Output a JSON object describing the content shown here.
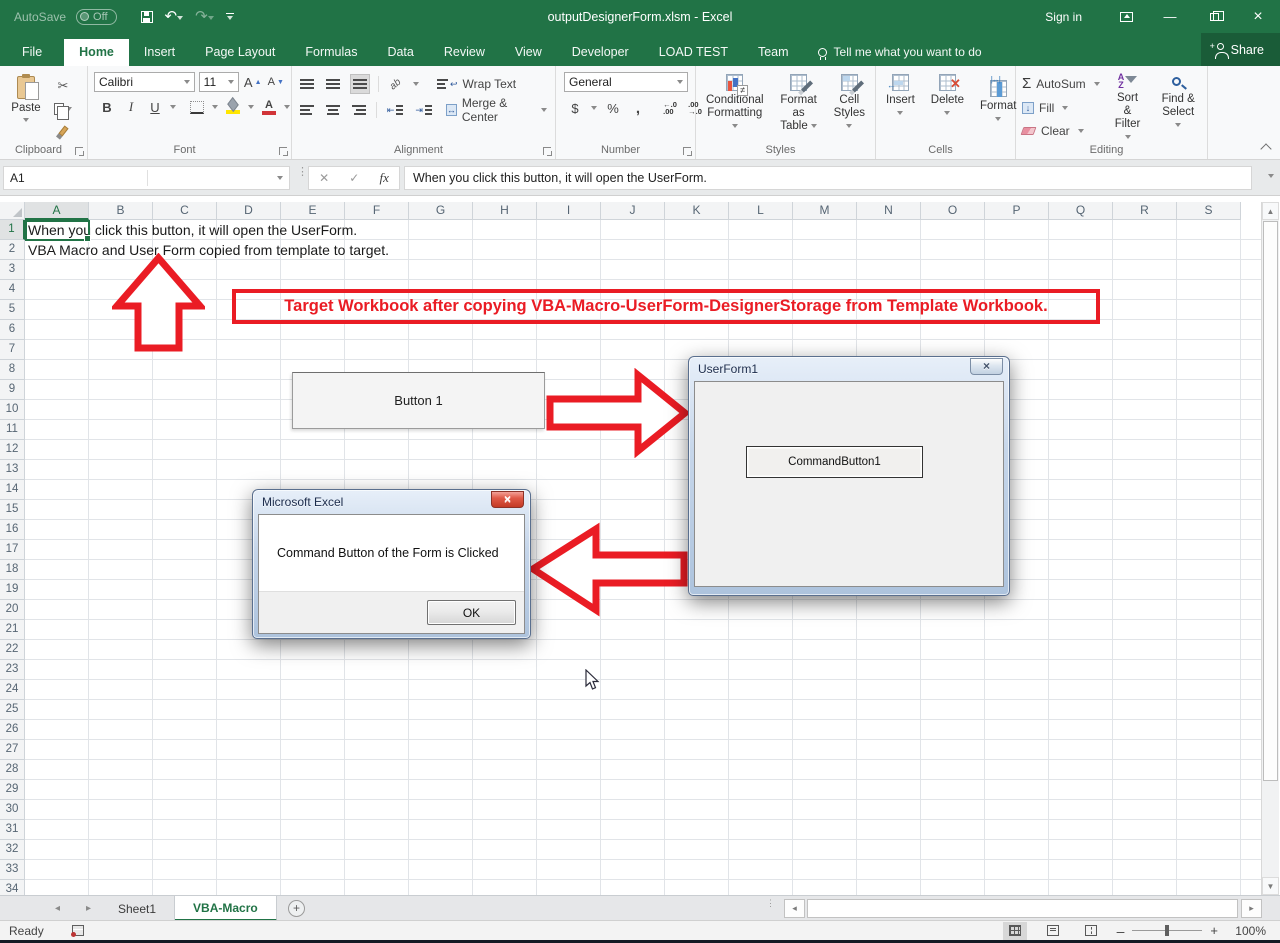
{
  "title_bar": {
    "autosave_label": "AutoSave",
    "autosave_state": "Off",
    "title": "outputDesignerForm.xlsm  -  Excel",
    "sign_in": "Sign in"
  },
  "ribbon_tabs": {
    "tabs": [
      {
        "label": "File",
        "active": false,
        "file": true
      },
      {
        "label": "Home",
        "active": true
      },
      {
        "label": "Insert"
      },
      {
        "label": "Page Layout"
      },
      {
        "label": "Formulas"
      },
      {
        "label": "Data"
      },
      {
        "label": "Review"
      },
      {
        "label": "View"
      },
      {
        "label": "Developer"
      },
      {
        "label": "LOAD TEST"
      },
      {
        "label": "Team"
      }
    ],
    "tell_me": "Tell me what you want to do",
    "share": "Share"
  },
  "ribbon": {
    "clipboard": {
      "paste": "Paste",
      "group": "Clipboard"
    },
    "font": {
      "name": "Calibri",
      "size": "11",
      "group": "Font"
    },
    "alignment": {
      "wrap": "Wrap Text",
      "merge": "Merge & Center",
      "group": "Alignment"
    },
    "number": {
      "format": "General",
      "group": "Number"
    },
    "styles": {
      "cf1": "Conditional",
      "cf2": "Formatting",
      "fat1": "Format as",
      "fat2": "Table",
      "cs1": "Cell",
      "cs2": "Styles",
      "group": "Styles"
    },
    "cells": {
      "insert": "Insert",
      "delete": "Delete",
      "format": "Format",
      "group": "Cells"
    },
    "editing": {
      "autosum": "AutoSum",
      "fill": "Fill",
      "clear": "Clear",
      "sf1": "Sort &",
      "sf2": "Filter",
      "fs1": "Find &",
      "fs2": "Select",
      "group": "Editing"
    }
  },
  "formula_bar": {
    "name_box": "A1",
    "fx": "fx",
    "formula": "When you click this button, it will open the UserForm."
  },
  "grid": {
    "columns": [
      "A",
      "B",
      "C",
      "D",
      "E",
      "F",
      "G",
      "H",
      "I",
      "J",
      "K",
      "L",
      "M",
      "N",
      "O",
      "P",
      "Q",
      "R",
      "S"
    ],
    "rows": [
      1,
      2,
      3,
      4,
      5,
      6,
      7,
      8,
      9,
      10,
      11,
      12,
      13,
      14,
      15,
      16,
      17,
      18,
      19,
      20,
      21,
      22,
      23,
      24,
      25,
      26,
      27,
      28,
      29,
      30,
      31,
      32,
      33,
      34
    ],
    "row1_text": "When you click this button, it will open the UserForm.",
    "row2_text": "VBA Macro and User Form copied from template to target."
  },
  "annotations": {
    "banner": "Target Workbook after copying VBA-Macro-UserForm-DesignerStorage from Template Workbook.",
    "red": "#ea1c24"
  },
  "worksheet_button": {
    "label": "Button 1"
  },
  "userform": {
    "title": "UserForm1",
    "button": "CommandButton1"
  },
  "msgbox": {
    "title": "Microsoft Excel",
    "message": "Command Button of the Form is Clicked",
    "ok": "OK"
  },
  "sheet_tabs": [
    {
      "label": "Sheet1",
      "active": false
    },
    {
      "label": "VBA-Macro",
      "active": true
    }
  ],
  "status_bar": {
    "ready": "Ready",
    "zoom": "100%"
  }
}
